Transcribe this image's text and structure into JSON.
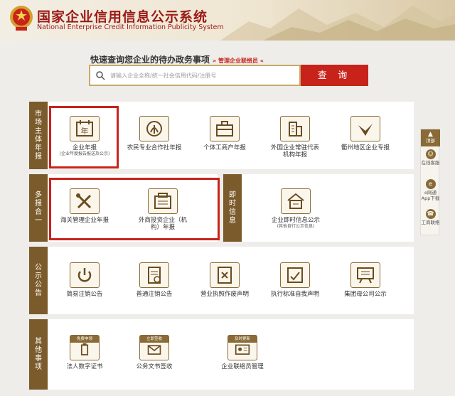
{
  "header": {
    "title_cn": "国家企业信用信息公示系统",
    "title_en": "National Enterprise Credit Information Publicity System"
  },
  "search": {
    "title": "快速查询您企业的待办政务事项",
    "guide": "» 管理企业联络员 «",
    "placeholder": "请输入企业全称/统一社会信用代码/注册号",
    "button_label": "查 询"
  },
  "sidebar": {
    "top": "顶部",
    "items": [
      {
        "label": "在线客服",
        "icon": "chat-icon"
      },
      {
        "label": "e网通App下载",
        "icon": "e-app-icon"
      },
      {
        "label": "工商联络",
        "icon": "contact-icon"
      }
    ]
  },
  "sections": {
    "annual": {
      "label": "市场主体年报",
      "items": [
        {
          "label": "企业年报",
          "sub": "(企业年度报告报送及公示)",
          "icon": "calendar-year-icon"
        },
        {
          "label": "农民专业合作社年报",
          "sub": "",
          "icon": "wheat-emblem-icon"
        },
        {
          "label": "个体工商户年报",
          "sub": "",
          "icon": "briefcase-icon"
        },
        {
          "label": "外国企业常驻代表机构年报",
          "sub": "",
          "icon": "building-icon"
        },
        {
          "label": "衢州地区企业专报",
          "sub": "",
          "icon": "bird-icon"
        }
      ]
    },
    "multi": {
      "label": "多报合一",
      "items": [
        {
          "label": "海关管理企业年报",
          "icon": "tools-icon"
        },
        {
          "label": "外商投资企业（机构）年报",
          "icon": "register-icon"
        }
      ]
    },
    "instant": {
      "label": "即时信息",
      "items": [
        {
          "label": "企业即时信息公示",
          "sub": "(其他自行公示信息)",
          "icon": "info-house-icon"
        }
      ]
    },
    "notice": {
      "label": "公示公告",
      "items": [
        {
          "label": "简易注销公告",
          "icon": "power-icon"
        },
        {
          "label": "普通注销公告",
          "icon": "cancel-doc-icon"
        },
        {
          "label": "营业执照作废声明",
          "icon": "license-void-icon"
        },
        {
          "label": "执行标准自我声明",
          "icon": "standard-doc-icon"
        },
        {
          "label": "集团母公司公示",
          "icon": "board-icon"
        }
      ]
    },
    "other": {
      "label": "其他事项",
      "items": [
        {
          "label": "法人数字证书",
          "tag": "免费申领",
          "icon": "usb-key-icon"
        },
        {
          "label": "公务文书签收",
          "tag": "立即签收",
          "icon": "mail-icon"
        },
        {
          "label": "企业联络员管理",
          "tag": "及时更新",
          "icon": "id-card-icon"
        }
      ]
    }
  }
}
